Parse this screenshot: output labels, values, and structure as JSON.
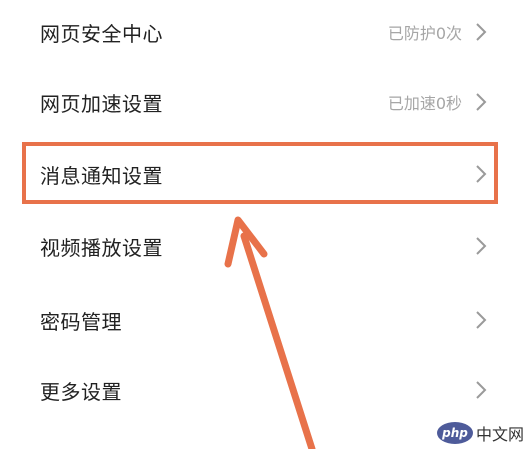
{
  "settings": {
    "items": [
      {
        "label": "网页安全中心",
        "value": "已防护0次"
      },
      {
        "label": "网页加速设置",
        "value": "已加速0秒"
      },
      {
        "label": "消息通知设置",
        "value": ""
      },
      {
        "label": "视频播放设置",
        "value": ""
      },
      {
        "label": "密码管理",
        "value": ""
      },
      {
        "label": "更多设置",
        "value": ""
      }
    ]
  },
  "annotation": {
    "highlight_color": "#e8724a",
    "arrow_color": "#e8724a"
  },
  "watermark": {
    "logo_text": "php",
    "text": "中文网"
  }
}
